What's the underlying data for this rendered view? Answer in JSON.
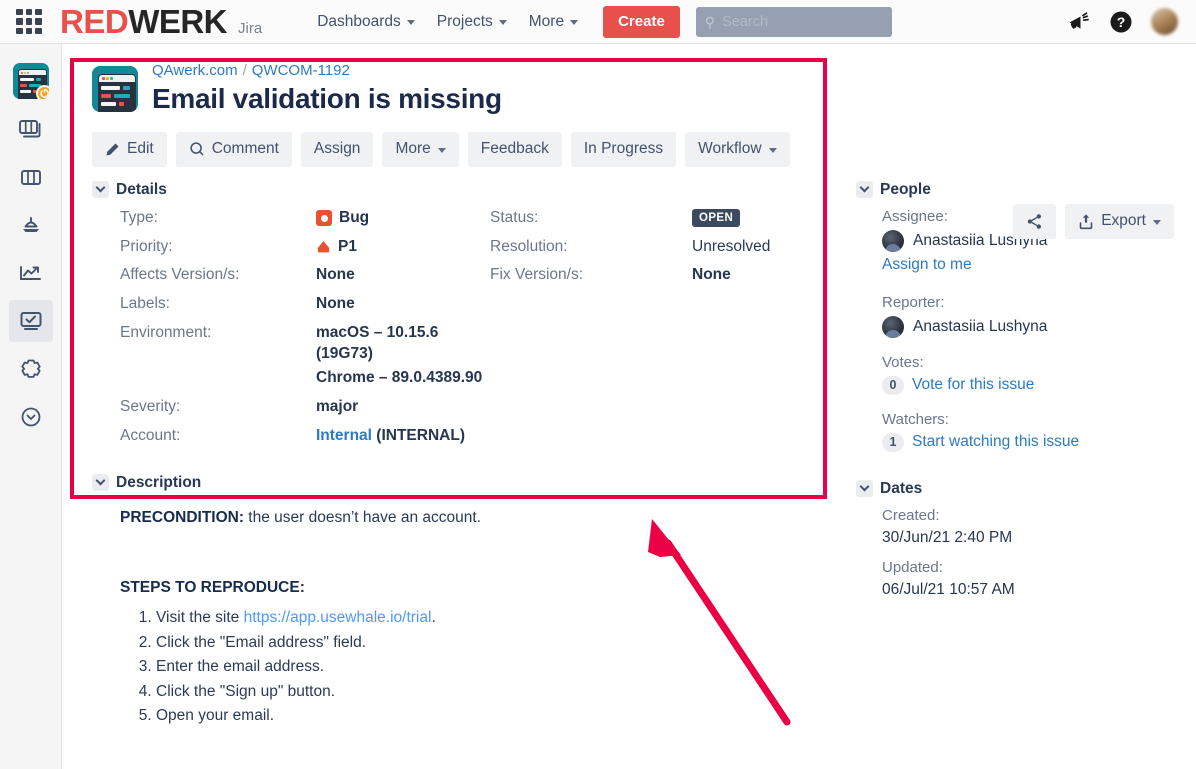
{
  "topnav": {
    "app_switcher": "app-switcher-grid",
    "logo_red": "RED",
    "logo_dark": "WERK",
    "product": "Jira",
    "links": [
      {
        "label": "Dashboards",
        "has_caret": true
      },
      {
        "label": "Projects",
        "has_caret": true
      },
      {
        "label": "More",
        "has_caret": true
      }
    ],
    "create_label": "Create",
    "search_placeholder": "Search",
    "announce_icon": "megaphone-icon",
    "help_icon": "help-circle-icon",
    "avatar": "user-avatar"
  },
  "sidebar": {
    "items": [
      {
        "name": "project-avatar",
        "label": "Project avatar",
        "active": false
      },
      {
        "name": "backlog-icon",
        "label": "Backlog",
        "active": false
      },
      {
        "name": "board-icon",
        "label": "Board",
        "active": false
      },
      {
        "name": "releases-icon",
        "label": "Releases",
        "active": false
      },
      {
        "name": "reports-icon",
        "label": "Reports",
        "active": false
      },
      {
        "name": "issues-icon",
        "label": "Issues",
        "active": true
      },
      {
        "name": "components-icon",
        "label": "Components",
        "active": false
      },
      {
        "name": "recent-icon",
        "label": "Recent",
        "active": false
      }
    ]
  },
  "issue": {
    "breadcrumb": {
      "project": "QAwerk.com",
      "separator": "/",
      "key": "QWCOM-1192"
    },
    "title": "Email validation is missing",
    "toolbar": {
      "edit": "Edit",
      "comment": "Comment",
      "assign": "Assign",
      "more": "More",
      "feedback": "Feedback",
      "in_progress": "In Progress",
      "workflow": "Workflow",
      "share": "share-icon",
      "export": "Export"
    },
    "details": {
      "heading": "Details",
      "type_label": "Type:",
      "type_value": "Bug",
      "priority_label": "Priority:",
      "priority_value": "P1",
      "affects_label": "Affects Version/s:",
      "affects_value": "None",
      "labels_label": "Labels:",
      "labels_value": "None",
      "environment_label": "Environment:",
      "environment_line1": "macOS – 10.15.6 (19G73)",
      "environment_line2": "Chrome – 89.0.4389.90",
      "severity_label": "Severity:",
      "severity_value": "major",
      "account_label": "Account:",
      "account_link": "Internal",
      "account_suffix": "(INTERNAL)",
      "status_label": "Status:",
      "status_value": "OPEN",
      "resolution_label": "Resolution:",
      "resolution_value": "Unresolved",
      "fix_label": "Fix Version/s:",
      "fix_value": "None"
    },
    "description": {
      "heading": "Description",
      "precondition_label": "PRECONDITION:",
      "precondition_text": " the user doesn’t have an account.",
      "steps_heading": "STEPS TO REPRODUCE:",
      "steps": [
        {
          "prefix": "Visit the site ",
          "link": "https://app.usewhale.io/trial",
          "suffix": "."
        },
        {
          "prefix": "Click the \"Email address\" field.",
          "link": "",
          "suffix": ""
        },
        {
          "prefix": "Enter the email address.",
          "link": "",
          "suffix": ""
        },
        {
          "prefix": "Click the \"Sign up\" button.",
          "link": "",
          "suffix": ""
        },
        {
          "prefix": "Open your email.",
          "link": "",
          "suffix": ""
        }
      ]
    },
    "people": {
      "heading": "People",
      "assignee_label": "Assignee:",
      "assignee_name": "Anastasiia Lushyna",
      "assign_to_me": "Assign to me",
      "reporter_label": "Reporter:",
      "reporter_name": "Anastasiia Lushyna",
      "votes_label": "Votes:",
      "votes_count": "0",
      "votes_link": "Vote for this issue",
      "watchers_label": "Watchers:",
      "watchers_count": "1",
      "watchers_link": "Start watching this issue"
    },
    "dates": {
      "heading": "Dates",
      "created_label": "Created:",
      "created_value": "30/Jun/21 2:40 PM",
      "updated_label": "Updated:",
      "updated_value": "06/Jul/21 10:57 AM"
    }
  },
  "annotations": {
    "highlight_color": "#ea0044",
    "box": "details-highlight-box",
    "arrow": "pointer-arrow"
  },
  "colors": {
    "brand_red": "#e8504b",
    "link_blue": "#2d7ac4",
    "bug_orange": "#e8522f",
    "status_navy": "#3c4a60",
    "project_teal": "#128896"
  }
}
